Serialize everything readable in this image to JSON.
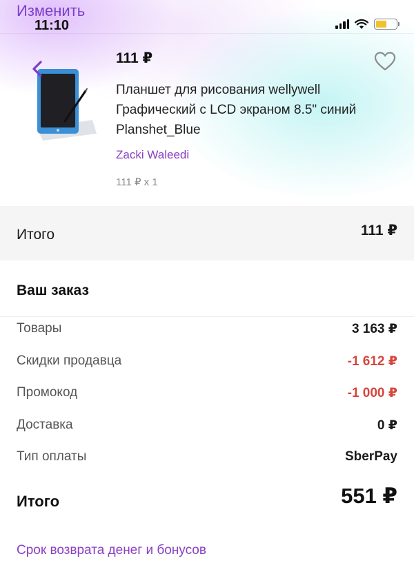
{
  "nav": {
    "edit_label": "Изменить"
  },
  "status_bar": {
    "time": "11:10"
  },
  "product": {
    "price": "111 ₽",
    "title": "Планшет для рисования wellywell Графический с LCD экраном 8.5\" синий Planshet_Blue",
    "seller": "Zacki Waleedi",
    "quantity_line": "111 ₽ x 1",
    "image_icon": "tablet-icon"
  },
  "subtotal": {
    "label": "Итого",
    "value": "111 ₽"
  },
  "order": {
    "title": "Ваш заказ",
    "rows": [
      {
        "label": "Товары",
        "value": "3 163 ₽",
        "highlight": false
      },
      {
        "label": "Скидки продавца",
        "value": "-1 612 ₽",
        "highlight": true
      },
      {
        "label": "Промокод",
        "value": "-1 000 ₽",
        "highlight": true
      },
      {
        "label": "Доставка",
        "value": "0 ₽",
        "highlight": false
      },
      {
        "label": "Тип оплаты",
        "value": "SberPay",
        "highlight": false
      }
    ],
    "total_label": "Итого",
    "total_value": "551 ₽"
  },
  "refund_link": "Срок возврата денег и бонусов",
  "colors": {
    "accent": "#8a3fc2",
    "discount": "#d6453d",
    "band": "#f5f5f5"
  }
}
